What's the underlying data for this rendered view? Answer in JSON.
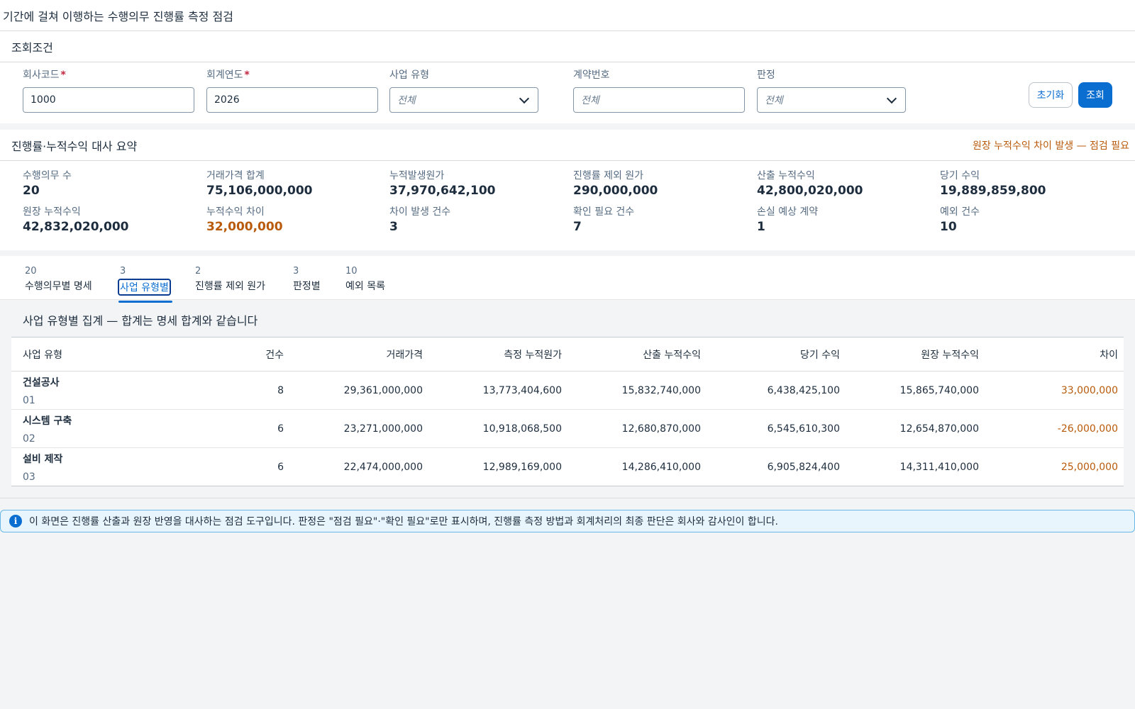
{
  "title": "기간에 걸쳐 이행하는 수행의무 진행률 측정 점검",
  "filters": {
    "heading": "조회조건",
    "company_code": {
      "label": "회사코드",
      "value": "1000"
    },
    "fiscal_year": {
      "label": "회계연도",
      "value": "2026"
    },
    "business_type": {
      "label": "사업 유형",
      "placeholder": "전체"
    },
    "contract_no": {
      "label": "계약번호",
      "placeholder": "전체"
    },
    "judgement": {
      "label": "판정",
      "placeholder": "전체"
    },
    "reset_label": "초기화",
    "search_label": "조회"
  },
  "summary": {
    "heading": "진행률·누적수익 대사 요약",
    "alert": "원장 누적수익 차이 발생 — 점검 필요",
    "kpis": [
      {
        "label": "수행의무 수",
        "value": "20"
      },
      {
        "label": "거래가격 합계",
        "value": "75,106,000,000"
      },
      {
        "label": "누적발생원가",
        "value": "37,970,642,100"
      },
      {
        "label": "진행률 제외 원가",
        "value": "290,000,000"
      },
      {
        "label": "산출 누적수익",
        "value": "42,800,020,000"
      },
      {
        "label": "당기 수익",
        "value": "19,889,859,800"
      },
      {
        "label": "원장 누적수익",
        "value": "42,832,020,000"
      },
      {
        "label": "누적수익 차이",
        "value": "32,000,000"
      },
      {
        "label": "차이 발생 건수",
        "value": "3"
      },
      {
        "label": "확인 필요 건수",
        "value": "7"
      },
      {
        "label": "손실 예상 계약",
        "value": "1"
      },
      {
        "label": "예외 건수",
        "value": "10"
      }
    ]
  },
  "tabs": [
    {
      "count": "20",
      "label": "수행의무별 명세"
    },
    {
      "count": "3",
      "label": "사업 유형별"
    },
    {
      "count": "2",
      "label": "진행률 제외 원가"
    },
    {
      "count": "3",
      "label": "판정별"
    },
    {
      "count": "10",
      "label": "예외 목록"
    }
  ],
  "table": {
    "title": "사업 유형별 집계 — 합계는 명세 합계와 같습니다",
    "headers": [
      "사업 유형",
      "건수",
      "거래가격",
      "측정 누적원가",
      "산출 누적수익",
      "당기 수익",
      "원장 누적수익",
      "차이"
    ],
    "rows": [
      {
        "name": "건설공사",
        "code": "01",
        "count": "8",
        "price": "29,361,000,000",
        "cost": "13,773,404,600",
        "calc_rev": "15,832,740,000",
        "cur_rev": "6,438,425,100",
        "ledger_rev": "15,865,740,000",
        "diff": "33,000,000"
      },
      {
        "name": "시스템 구축",
        "code": "02",
        "count": "6",
        "price": "23,271,000,000",
        "cost": "10,918,068,500",
        "calc_rev": "12,680,870,000",
        "cur_rev": "6,545,610,300",
        "ledger_rev": "12,654,870,000",
        "diff": "-26,000,000"
      },
      {
        "name": "설비 제작",
        "code": "03",
        "count": "6",
        "price": "22,474,000,000",
        "cost": "12,989,169,000",
        "calc_rev": "14,286,410,000",
        "cur_rev": "6,905,824,400",
        "ledger_rev": "14,311,410,000",
        "diff": "25,000,000"
      }
    ]
  },
  "info": {
    "icon": "info-icon",
    "text": "이 화면은 진행률 산출과 원장 반영을 대사하는 점검 도구입니다. 판정은 \"점검 필요\"·\"확인 필요\"로만 표시하며, 진행률 측정 방법과 회계처리의 최종 판단은 회사와 감사인이 합니다."
  },
  "colors": {
    "accent": "#0a6ed1",
    "warning": "#b85a0a",
    "required": "#c0253f",
    "info_bg": "#e8f5fd"
  }
}
